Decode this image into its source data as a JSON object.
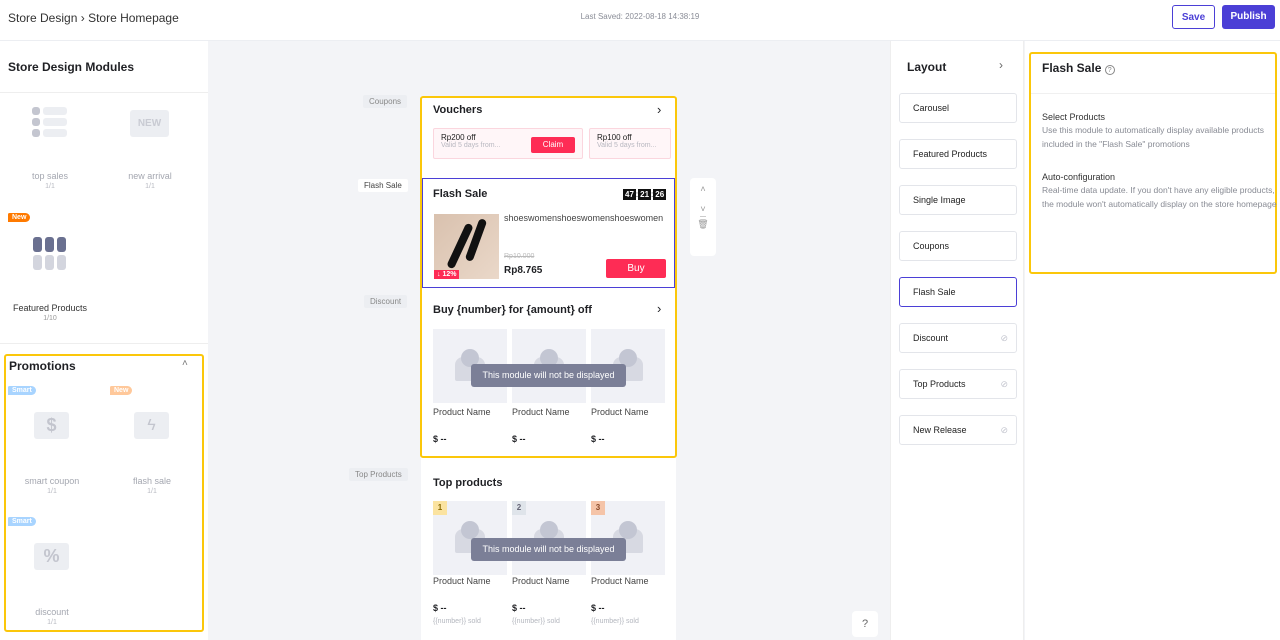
{
  "header": {
    "breadcrumb": [
      "Store Design",
      "Store Homepage"
    ],
    "last_saved": "Last Saved: 2022-08-18 14:38:19",
    "save": "Save",
    "publish": "Publish",
    "accent": "#4b3fd6"
  },
  "modules_panel": {
    "title": "Store Design Modules",
    "items": [
      {
        "name": "top sales",
        "count": "1/1"
      },
      {
        "name": "new arrival",
        "count": "1/1",
        "icon_text": "NEW"
      },
      {
        "name": "Featured Products",
        "count": "1/10",
        "badge": "New"
      }
    ],
    "promotions": {
      "title": "Promotions",
      "items": [
        {
          "name": "smart coupon",
          "count": "1/1",
          "badge": "Smart",
          "icon": "dollar-coupon-icon"
        },
        {
          "name": "flash sale",
          "count": "1/1",
          "badge": "New",
          "icon": "lightning-icon"
        },
        {
          "name": "discount",
          "count": "1/1",
          "badge": "Smart",
          "icon": "percent-icon"
        }
      ]
    }
  },
  "canvas": {
    "side_tags": [
      "Coupons",
      "Flash Sale",
      "Discount",
      "Top Products"
    ],
    "vouchers": {
      "title": "Vouchers",
      "items": [
        {
          "amount": "Rp200 off",
          "validity": "Valid 5 days from...",
          "claim": "Claim"
        },
        {
          "amount": "Rp100 off",
          "validity": "Valid 5 days from..."
        }
      ]
    },
    "flash_sale": {
      "title": "Flash Sale",
      "timer": [
        "47",
        "21",
        "26"
      ],
      "product_name": "shoeswomenshoeswomenshoeswomen",
      "original_price": "Rp10.000",
      "price": "Rp8.765",
      "discount": "12%",
      "buy": "Buy"
    },
    "discount": {
      "title": "Buy {number} for {amount} off",
      "overlay": "This module will not be displayed",
      "products": [
        {
          "name": "Product Name",
          "price": "$ --"
        },
        {
          "name": "Product Name",
          "price": "$ --"
        },
        {
          "name": "Product Name",
          "price": "$ --"
        }
      ]
    },
    "top_products": {
      "title": "Top products",
      "overlay": "This module will not be displayed",
      "products": [
        {
          "rank": "1",
          "name": "Product Name",
          "price": "$ --",
          "sold": "{{number}} sold"
        },
        {
          "rank": "2",
          "name": "Product Name",
          "price": "$ --",
          "sold": "{{number}} sold"
        },
        {
          "rank": "3",
          "name": "Product Name",
          "price": "$ --",
          "sold": "{{number}} sold"
        }
      ]
    }
  },
  "layout_panel": {
    "title": "Layout",
    "items": [
      {
        "label": "Carousel"
      },
      {
        "label": "Featured Products"
      },
      {
        "label": "Single Image"
      },
      {
        "label": "Coupons"
      },
      {
        "label": "Flash Sale",
        "selected": true
      },
      {
        "label": "Discount",
        "hidden": true
      },
      {
        "label": "Top Products",
        "hidden": true
      },
      {
        "label": "New Release",
        "hidden": true
      }
    ]
  },
  "settings_panel": {
    "title": "Flash Sale",
    "sections": [
      {
        "heading": "Select Products",
        "text": "Use this module to automatically display available products included in the \"Flash Sale\" promotions"
      },
      {
        "heading": "Auto-configuration",
        "text": "Real-time data update. If you don't have any eligible products, the module won't automatically display on the store homepage"
      }
    ]
  }
}
